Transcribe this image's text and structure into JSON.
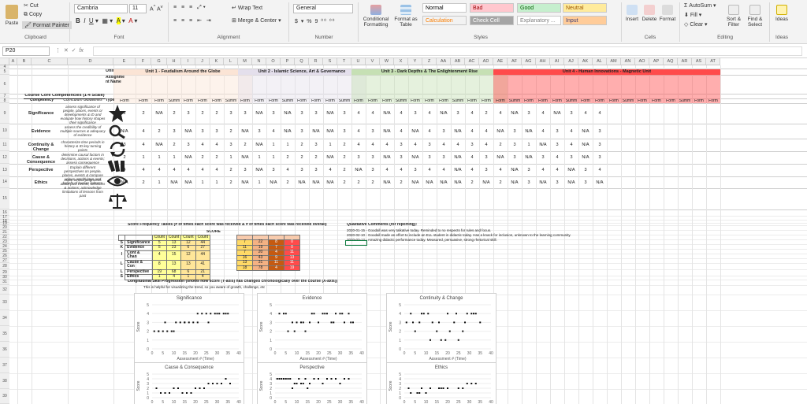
{
  "ribbon": {
    "clipboard": {
      "cut": "Cut",
      "copy": "Copy",
      "paste": "Paste",
      "painter": "Format Painter",
      "group": "Clipboard"
    },
    "font": {
      "name": "Cambria",
      "size": "11",
      "group": "Font"
    },
    "alignment": {
      "wrap": "Wrap Text",
      "merge": "Merge & Center",
      "group": "Alignment"
    },
    "number": {
      "format": "General",
      "group": "Number"
    },
    "styles": {
      "conditional": "Conditional Formatting",
      "table": "Format as Table",
      "items": [
        {
          "label": "Normal",
          "bg": "#ffffff",
          "fg": "#000000"
        },
        {
          "label": "Bad",
          "bg": "#ffc7ce",
          "fg": "#9c0006"
        },
        {
          "label": "Good",
          "bg": "#c6efce",
          "fg": "#006100"
        },
        {
          "label": "Neutral",
          "bg": "#ffeb9c",
          "fg": "#9c5700"
        },
        {
          "label": "Calculation",
          "bg": "#f2f2f2",
          "fg": "#fa7d00"
        },
        {
          "label": "Check Cell",
          "bg": "#a5a5a5",
          "fg": "#ffffff"
        },
        {
          "label": "Explanatory ...",
          "bg": "#ffffff",
          "fg": "#7f7f7f"
        },
        {
          "label": "Input",
          "bg": "#ffcc99",
          "fg": "#3f3f76"
        }
      ],
      "group": "Styles"
    },
    "cells": {
      "insert": "Insert",
      "delete": "Delete",
      "format": "Format",
      "group": "Cells"
    },
    "editing": {
      "autosum": "AutoSum",
      "fill": "Fill",
      "clear": "Clear",
      "sort": "Sort & Filter",
      "find": "Find & Select",
      "group": "Editing"
    },
    "ideas": {
      "label": "Ideas",
      "group": "Ideas"
    }
  },
  "formula_bar": {
    "name_box": "P20",
    "fx": "fx",
    "value": ""
  },
  "columns": [
    "A",
    "B",
    "C",
    "D",
    "E",
    "F",
    "G",
    "H",
    "I",
    "J",
    "K",
    "L",
    "M",
    "N",
    "O",
    "P",
    "Q",
    "R",
    "S",
    "T",
    "U",
    "V",
    "W",
    "X",
    "Y",
    "Z",
    "AA",
    "AB",
    "AC",
    "AD",
    "AE",
    "AF",
    "AG",
    "AH",
    "AI",
    "AJ",
    "AK",
    "AL",
    "AM",
    "AN",
    "AO",
    "AP",
    "AQ",
    "AR",
    "AS",
    "AT"
  ],
  "rows": [
    "4",
    "5",
    "6",
    "7",
    "8",
    "9",
    "10",
    "11",
    "12",
    "13",
    "14",
    "15",
    "16",
    "17",
    "18",
    "19",
    "20",
    "21",
    "22",
    "23",
    "24",
    "25",
    "26",
    "27",
    "28",
    "29",
    "30",
    "31",
    "32",
    "33",
    "34",
    "35",
    "36",
    "37",
    "38",
    "39",
    "40"
  ],
  "units": [
    {
      "label": "Unit 1 - Feudalism Around the Globe",
      "color": "#fbe4d5"
    },
    {
      "label": "Unit 2 - Islamic Science, Art & Governance",
      "color": "#e4dfec"
    },
    {
      "label": "Unit 3 - Dark Depths & The Enlightenment Rise",
      "color": "#c6e0b4"
    },
    {
      "label": "Unit 4 - Human Innovations - Magnetic Unit",
      "color": "#ff4b4b"
    }
  ],
  "sheet_header": {
    "unit": "Unit",
    "heading": "Course Core Competencies (1-4 Scale)",
    "competency": "Competency",
    "curriculum": "Curriculum Guidelines",
    "assign": "Assignme nt Name",
    "type": "Type"
  },
  "competencies": [
    {
      "name": "Significance",
      "desc": "assess significance of people, places, events or developments & ID and evaluate how history shapes their significance",
      "scores": [
        "2",
        "2",
        "N/A",
        "2",
        "3",
        "2",
        "2",
        "3",
        "3",
        "N/A",
        "3",
        "N/A",
        "3",
        "3",
        "N/A",
        "3",
        "4",
        "4",
        "N/A",
        "4",
        "3",
        "4",
        "N/A",
        "3",
        "4",
        "2",
        "4",
        "N/A",
        "3",
        "4",
        "N/A",
        "3",
        "4",
        "4"
      ]
    },
    {
      "name": "Evidence",
      "desc": "assess the credibility of multiple sources & adequacy of evidence",
      "scores": [
        "N/A",
        "4",
        "2",
        "3",
        "N/A",
        "3",
        "3",
        "2",
        "N/A",
        "3",
        "4",
        "N/A",
        "3",
        "N/A",
        "N/A",
        "3",
        "4",
        "3",
        "N/A",
        "4",
        "N/A",
        "4",
        "3",
        "N/A",
        "4",
        "4",
        "N/A",
        "3",
        "N/A",
        "4",
        "3",
        "4",
        "N/A",
        "3"
      ]
    },
    {
      "name": "Continuity & Change",
      "desc": "characterize time periods in history & ID key turning points",
      "scores": [
        "3",
        "4",
        "N/A",
        "2",
        "3",
        "4",
        "4",
        "3",
        "2",
        "N/A",
        "1",
        "1",
        "2",
        "3",
        "1",
        "2",
        "4",
        "4",
        "4",
        "3",
        "4",
        "3",
        "4",
        "4",
        "3",
        "4",
        "2",
        "3",
        "1",
        "N/A",
        "3",
        "4",
        "N/A",
        "3"
      ]
    },
    {
      "name": "Cause & Consequence",
      "desc": "determine causal factors in decisions, actions & events; assess consequence",
      "scores": [
        "2",
        "1",
        "1",
        "1",
        "N/A",
        "2",
        "2",
        "1",
        "N/A",
        "1",
        "1",
        "2",
        "2",
        "2",
        "N/A",
        "2",
        "3",
        "3",
        "N/A",
        "3",
        "N/A",
        "3",
        "3",
        "N/A",
        "4",
        "3",
        "N/A",
        "3",
        "N/A",
        "3",
        "4",
        "3",
        "N/A",
        "3"
      ]
    },
    {
      "name": "Perspective",
      "desc": "Explain different perspectives on people, places, events & compare values, worldviews and beliefs of human cultures",
      "scores": [
        "4",
        "4",
        "4",
        "4",
        "4",
        "4",
        "4",
        "2",
        "3",
        "N/A",
        "3",
        "4",
        "3",
        "3",
        "4",
        "2",
        "N/A",
        "3",
        "4",
        "4",
        "3",
        "4",
        "4",
        "N/A",
        "4",
        "3",
        "4",
        "N/A",
        "3",
        "4",
        "4",
        "N/A",
        "3",
        "4"
      ]
    },
    {
      "name": "Ethics",
      "desc": "Make ethical judgments about past events, decisions & actions; acknowledge limitations of lessons from past",
      "scores": [
        "N/A",
        "2",
        "1",
        "N/A",
        "N/A",
        "1",
        "1",
        "2",
        "N/A",
        "1",
        "N/A",
        "2",
        "N/A",
        "N/A",
        "N/A",
        "2",
        "2",
        "2",
        "N/A",
        "2",
        "N/A",
        "N/A",
        "N/A",
        "N/A",
        "2",
        "N/A",
        "2",
        "N/A",
        "3",
        "N/A",
        "3",
        "N/A",
        "3",
        "N/A"
      ]
    }
  ],
  "tally": {
    "title": "Score Frequency Tallies (# of times each score was received & # of times each score was received overall)",
    "score_label": "SCORE",
    "side": [
      "S",
      "K",
      "I",
      "L",
      "L",
      "S"
    ],
    "headers": [
      "Count",
      "Count",
      "Count",
      "Count"
    ],
    "rows": [
      {
        "name": "Significance",
        "v": [
          "5",
          "13",
          "12",
          "44"
        ]
      },
      {
        "name": "Evidence",
        "v": [
          "5",
          "23",
          "6",
          "27"
        ]
      },
      {
        "name": "Cont & Chan",
        "v": [
          "4",
          "15",
          "12",
          "44"
        ]
      },
      {
        "name": "Cause & Con",
        "v": [
          "8",
          "13",
          "13",
          "41"
        ]
      },
      {
        "name": "Perspective",
        "v": [
          "19",
          "68",
          "6",
          "21"
        ]
      },
      {
        "name": "Ethics",
        "v": [
          "1",
          "4",
          "1",
          "4"
        ]
      }
    ],
    "right": [
      [
        "7",
        "22",
        "8",
        "0"
      ],
      [
        "11",
        "19",
        "7",
        "0"
      ],
      [
        "7",
        "20",
        "4",
        "11"
      ],
      [
        "16",
        "43",
        "9",
        "13"
      ],
      [
        "13",
        "31",
        "11",
        "11"
      ],
      [
        "18",
        "78",
        "4",
        "19"
      ]
    ]
  },
  "qualitative": {
    "title": "Qualitative Comments (for reporting):",
    "lines": [
      "2020-01-15 - Goodall was very talkative today. Reminded to no respects for rules and focus.",
      "2020-02-10 - Goodall made an effort to include an ELL student in didactic today. Has a knack for inclusion, unknown to the learning community.",
      "2020-03-12 - Amazing didactic performance today. Measured, persuasive, strong rhetorical skill."
    ]
  },
  "longitudinal": {
    "title": "Longitudinal Skill Progression (shows how score (Y-axis) has changed chronologically over the course (X-axis))",
    "subtitle": "This is helpful for visualizing the trend, so you aware of growth, challenge, etc"
  },
  "chart_data": [
    {
      "type": "scatter",
      "title": "Significance",
      "xlabel": "Assessment # (Time)",
      "ylabel": "Score",
      "xlim": [
        0,
        40
      ],
      "ylim": [
        0,
        5
      ],
      "x": [
        1,
        3,
        5,
        7,
        9,
        11,
        13,
        15,
        17,
        19,
        21,
        23,
        25,
        27,
        29,
        31,
        33,
        35,
        3,
        6,
        10,
        15,
        21,
        26,
        30,
        34
      ],
      "y": [
        2,
        2,
        2,
        2,
        2,
        3,
        3,
        3,
        3,
        3,
        3,
        4,
        4,
        4,
        4,
        4,
        4,
        4,
        2,
        3,
        2,
        3,
        4,
        3,
        4,
        4
      ]
    },
    {
      "type": "scatter",
      "title": "Evidence",
      "xlabel": "Assessment # (Time)",
      "ylabel": "Score",
      "xlim": [
        0,
        40
      ],
      "ylim": [
        0,
        5
      ],
      "x": [
        2,
        4,
        6,
        8,
        10,
        12,
        14,
        16,
        18,
        20,
        22,
        24,
        26,
        28,
        30,
        32,
        34,
        36,
        5,
        9,
        13,
        17,
        23,
        27,
        31,
        35
      ],
      "y": [
        4,
        4,
        2,
        3,
        3,
        3,
        2,
        3,
        4,
        3,
        4,
        4,
        3,
        4,
        4,
        3,
        4,
        3,
        4,
        2,
        3,
        4,
        4,
        3,
        4,
        3
      ]
    },
    {
      "type": "scatter",
      "title": "Continuity & Change",
      "xlabel": "Assessment # (Time)",
      "ylabel": "Score",
      "xlim": [
        0,
        40
      ],
      "ylim": [
        0,
        5
      ],
      "x": [
        1,
        3,
        5,
        7,
        9,
        11,
        13,
        15,
        17,
        19,
        21,
        23,
        25,
        27,
        29,
        31,
        33,
        35,
        4,
        8,
        12,
        16,
        20,
        24,
        28,
        32
      ],
      "y": [
        3,
        4,
        2,
        3,
        4,
        4,
        3,
        2,
        1,
        1,
        2,
        3,
        1,
        2,
        4,
        4,
        4,
        3,
        3,
        4,
        1,
        3,
        4,
        4,
        3,
        4
      ]
    },
    {
      "type": "scatter",
      "title": "Cause & Consequence",
      "xlabel": "Assessment # (Time)",
      "ylabel": "Score",
      "xlim": [
        0,
        40
      ],
      "ylim": [
        0,
        5
      ],
      "x": [
        2,
        4,
        6,
        8,
        10,
        12,
        14,
        16,
        18,
        20,
        22,
        24,
        26,
        28,
        30,
        32,
        34,
        36
      ],
      "y": [
        2,
        1,
        1,
        1,
        2,
        2,
        1,
        1,
        1,
        2,
        2,
        2,
        3,
        3,
        3,
        3,
        4,
        3
      ]
    },
    {
      "type": "scatter",
      "title": "Perspective",
      "xlabel": "Assessment # (Time)",
      "ylabel": "Score",
      "xlim": [
        0,
        40
      ],
      "ylim": [
        0,
        5
      ],
      "x": [
        1,
        2,
        3,
        4,
        5,
        6,
        7,
        8,
        9,
        10,
        11,
        12,
        13,
        14,
        15,
        16,
        18,
        20,
        22,
        24,
        26,
        28,
        30,
        32,
        34
      ],
      "y": [
        4,
        4,
        4,
        4,
        4,
        4,
        4,
        2,
        3,
        3,
        4,
        3,
        3,
        4,
        2,
        3,
        4,
        4,
        3,
        4,
        4,
        4,
        3,
        4,
        4
      ]
    },
    {
      "type": "scatter",
      "title": "Ethics",
      "xlabel": "Assessment # (Time)",
      "ylabel": "Score",
      "xlim": [
        0,
        40
      ],
      "ylim": [
        0,
        5
      ],
      "x": [
        2,
        3,
        6,
        7,
        8,
        10,
        12,
        16,
        17,
        18,
        20,
        25,
        27,
        29,
        31,
        33
      ],
      "y": [
        2,
        1,
        1,
        1,
        2,
        1,
        2,
        2,
        2,
        2,
        2,
        2,
        2,
        3,
        3,
        3
      ]
    }
  ]
}
